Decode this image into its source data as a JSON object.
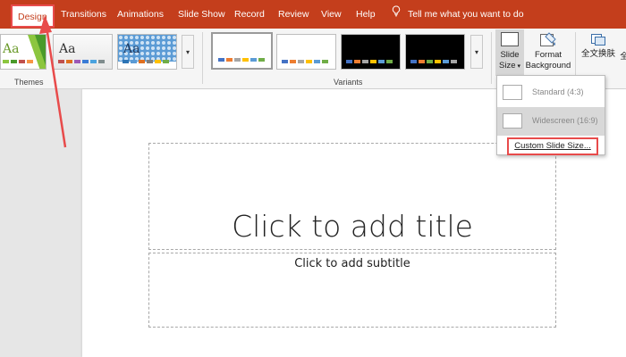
{
  "tabs": [
    {
      "label": "Design",
      "active": true
    },
    {
      "label": "Transitions"
    },
    {
      "label": "Animations"
    },
    {
      "label": "Slide Show"
    },
    {
      "label": "Record"
    },
    {
      "label": "Review"
    },
    {
      "label": "View"
    },
    {
      "label": "Help"
    }
  ],
  "tell_me": "Tell me what you want to do",
  "ribbon": {
    "themes_label": "Themes",
    "variants_label": "Variants",
    "theme_aa_1": "Aa",
    "theme_aa_2": "Aa",
    "theme_aa_3": "Aa",
    "slide_size": "Slide Size",
    "slide_size_line1": "Slide",
    "slide_size_line2": "Size",
    "format_background_line1": "Format",
    "format_background_line2": "Background",
    "chinese_convert": "全文换肤",
    "chinese_partial": "全"
  },
  "dropdown": {
    "standard": "Standard (4:3)",
    "widescreen": "Widescreen (16:9)",
    "custom": "Custom Slide Size..."
  },
  "slide": {
    "title_placeholder": "Click to add title",
    "subtitle_placeholder": "Click to add subtitle"
  },
  "colors": {
    "accent": "#c43e1c",
    "highlight": "#e84b4b"
  }
}
